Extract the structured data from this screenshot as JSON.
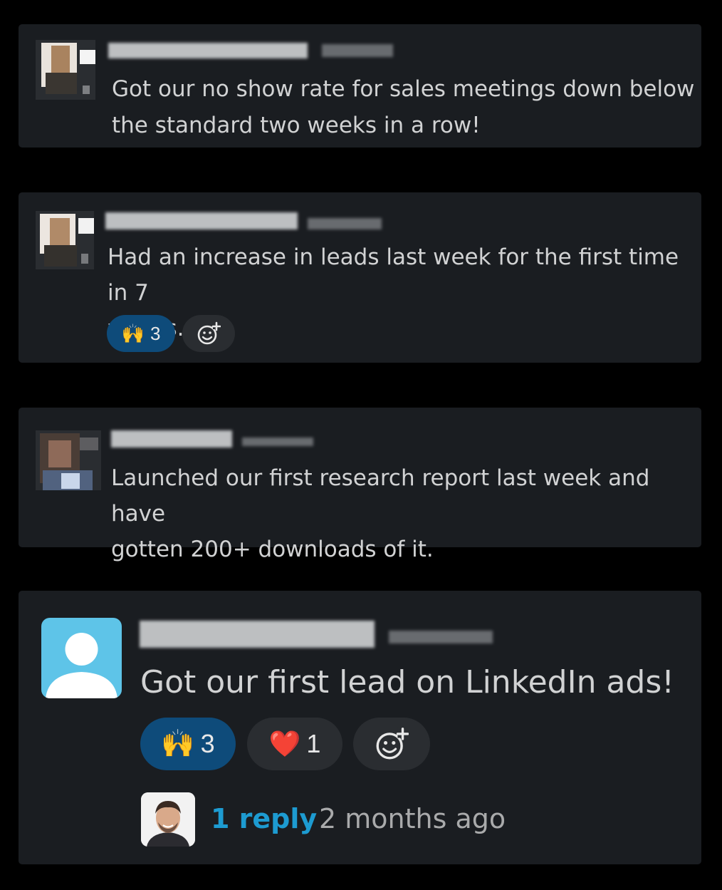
{
  "messages": [
    {
      "text": "Got our no show rate for sales meetings down below\nthe standard two weeks in a row!"
    },
    {
      "text": "Had an increase in leads last week for the first time in 7\nweeks.",
      "reactions": [
        {
          "emoji": "🙌",
          "count": "3",
          "active": true
        }
      ]
    },
    {
      "text": "Launched our first research report last week and have\ngotten 200+ downloads of it."
    },
    {
      "text": "Got our first lead on LinkedIn ads!",
      "reactions": [
        {
          "emoji": "🙌",
          "count": "3",
          "active": true
        },
        {
          "emoji": "❤️",
          "count": "1",
          "active": false
        }
      ],
      "thread": {
        "replies": "1 reply",
        "time": "2 months ago"
      }
    }
  ],
  "colors": {
    "background": "#000000",
    "card": "#1a1d21",
    "text": "#d1d2d3",
    "link": "#1d9bd1",
    "active_reaction": "#0e4b7a",
    "avatar_placeholder": "#5ec4e8"
  },
  "icons": {
    "add_reaction": "add-reaction-icon",
    "default_avatar": "user-silhouette-icon"
  }
}
